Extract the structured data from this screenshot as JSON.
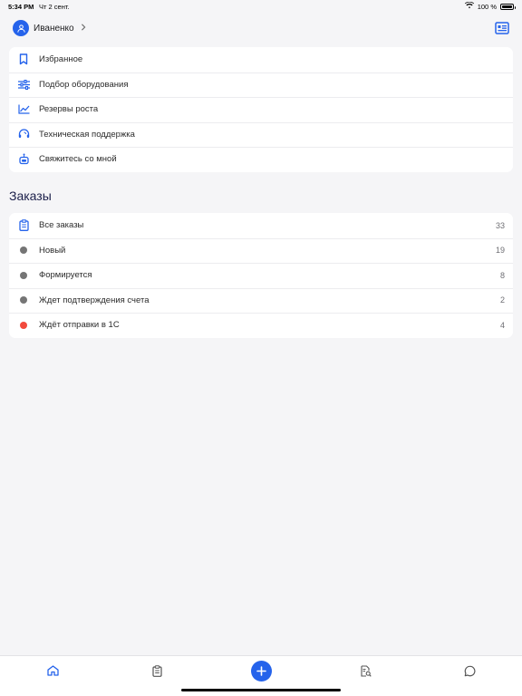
{
  "status_bar": {
    "time": "5:34 PM",
    "date": "Чт 2 сент.",
    "battery": "100 %",
    "icons": [
      "wifi-icon",
      "battery-icon"
    ]
  },
  "header": {
    "user_name": "Иваненко",
    "icons": [
      "avatar-icon",
      "chevron-right-icon",
      "profile-card-icon"
    ]
  },
  "menu": {
    "items": [
      {
        "label": "Избранное",
        "icon": "bookmark-icon"
      },
      {
        "label": "Подбор оборудования",
        "icon": "sliders-icon"
      },
      {
        "label": "Резервы роста",
        "icon": "chart-line-icon"
      },
      {
        "label": "Техническая поддержка",
        "icon": "headset-icon"
      },
      {
        "label": "Свяжитесь со мной",
        "icon": "robot-icon"
      }
    ]
  },
  "orders": {
    "title": "Заказы",
    "items": [
      {
        "label": "Все заказы",
        "count": "33",
        "icon": "clipboard-icon"
      },
      {
        "label": "Новый",
        "count": "19",
        "dot_color": "#757575"
      },
      {
        "label": "Формируется",
        "count": "8",
        "dot_color": "#757575"
      },
      {
        "label": "Ждет подтверждения счета",
        "count": "2",
        "dot_color": "#757575"
      },
      {
        "label": "Ждёт отправки в 1С",
        "count": "4",
        "dot_color": "#f24a3d"
      }
    ]
  },
  "tab_bar": {
    "tabs": [
      "home-icon",
      "clipboard-icon",
      "plus-icon",
      "document-search-icon",
      "chat-icon"
    ],
    "active": "home-icon"
  },
  "colors": {
    "accent": "#2563eb",
    "background": "#f5f5f7",
    "status_gray": "#757575",
    "status_red": "#f24a3d"
  }
}
